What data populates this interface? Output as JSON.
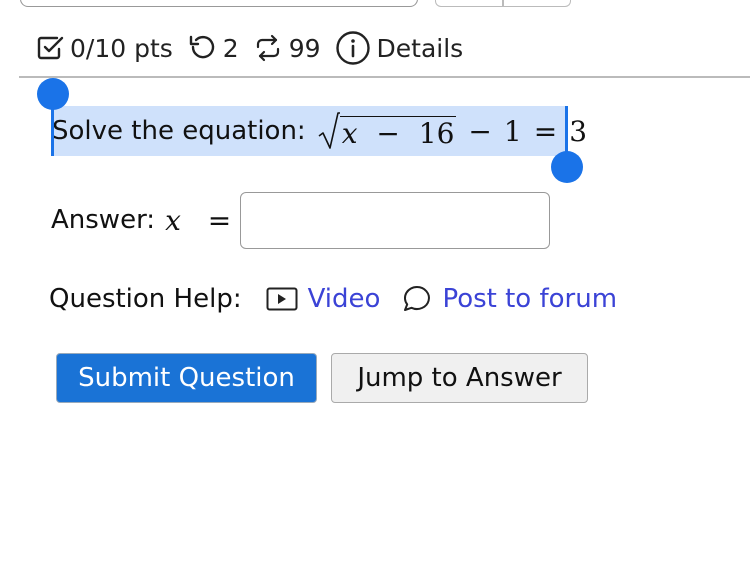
{
  "status": {
    "score": "0/10 pts",
    "retries": "2",
    "attempts": "99",
    "details_label": "Details"
  },
  "question": {
    "prompt": "Solve the equation:",
    "equation": {
      "radicand_var": "x",
      "radicand_op": "−",
      "radicand_num": "16",
      "op": "−",
      "subtract": "1",
      "equals": "=",
      "result": "3"
    }
  },
  "answer": {
    "label": "Answer:",
    "variable": "x",
    "equals": "=",
    "value": "",
    "placeholder": ""
  },
  "help": {
    "label": "Question Help:",
    "video_label": "Video",
    "forum_label": "Post to forum"
  },
  "buttons": {
    "submit_label": "Submit Question",
    "jump_label": "Jump to Answer"
  },
  "colors": {
    "accent": "#1a73e8",
    "link": "#3b43d6",
    "selection": "#cfe1fb",
    "primary_button": "#1a73d6"
  }
}
